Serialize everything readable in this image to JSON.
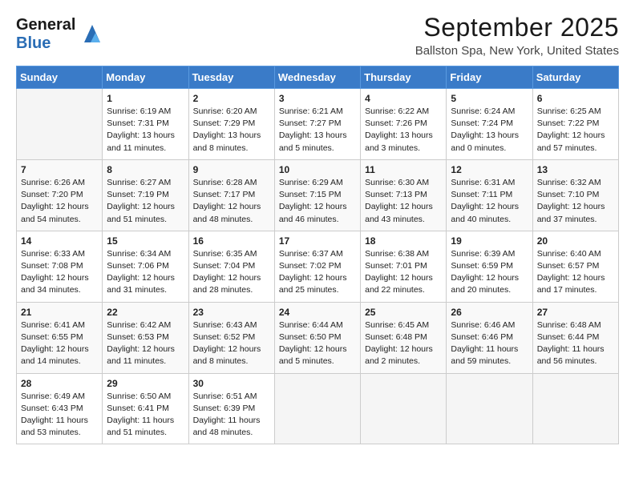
{
  "header": {
    "logo_general": "General",
    "logo_blue": "Blue",
    "month_title": "September 2025",
    "location": "Ballston Spa, New York, United States"
  },
  "columns": [
    "Sunday",
    "Monday",
    "Tuesday",
    "Wednesday",
    "Thursday",
    "Friday",
    "Saturday"
  ],
  "weeks": [
    [
      {
        "day": "",
        "info": ""
      },
      {
        "day": "1",
        "info": "Sunrise: 6:19 AM\nSunset: 7:31 PM\nDaylight: 13 hours\nand 11 minutes."
      },
      {
        "day": "2",
        "info": "Sunrise: 6:20 AM\nSunset: 7:29 PM\nDaylight: 13 hours\nand 8 minutes."
      },
      {
        "day": "3",
        "info": "Sunrise: 6:21 AM\nSunset: 7:27 PM\nDaylight: 13 hours\nand 5 minutes."
      },
      {
        "day": "4",
        "info": "Sunrise: 6:22 AM\nSunset: 7:26 PM\nDaylight: 13 hours\nand 3 minutes."
      },
      {
        "day": "5",
        "info": "Sunrise: 6:24 AM\nSunset: 7:24 PM\nDaylight: 13 hours\nand 0 minutes."
      },
      {
        "day": "6",
        "info": "Sunrise: 6:25 AM\nSunset: 7:22 PM\nDaylight: 12 hours\nand 57 minutes."
      }
    ],
    [
      {
        "day": "7",
        "info": "Sunrise: 6:26 AM\nSunset: 7:20 PM\nDaylight: 12 hours\nand 54 minutes."
      },
      {
        "day": "8",
        "info": "Sunrise: 6:27 AM\nSunset: 7:19 PM\nDaylight: 12 hours\nand 51 minutes."
      },
      {
        "day": "9",
        "info": "Sunrise: 6:28 AM\nSunset: 7:17 PM\nDaylight: 12 hours\nand 48 minutes."
      },
      {
        "day": "10",
        "info": "Sunrise: 6:29 AM\nSunset: 7:15 PM\nDaylight: 12 hours\nand 46 minutes."
      },
      {
        "day": "11",
        "info": "Sunrise: 6:30 AM\nSunset: 7:13 PM\nDaylight: 12 hours\nand 43 minutes."
      },
      {
        "day": "12",
        "info": "Sunrise: 6:31 AM\nSunset: 7:11 PM\nDaylight: 12 hours\nand 40 minutes."
      },
      {
        "day": "13",
        "info": "Sunrise: 6:32 AM\nSunset: 7:10 PM\nDaylight: 12 hours\nand 37 minutes."
      }
    ],
    [
      {
        "day": "14",
        "info": "Sunrise: 6:33 AM\nSunset: 7:08 PM\nDaylight: 12 hours\nand 34 minutes."
      },
      {
        "day": "15",
        "info": "Sunrise: 6:34 AM\nSunset: 7:06 PM\nDaylight: 12 hours\nand 31 minutes."
      },
      {
        "day": "16",
        "info": "Sunrise: 6:35 AM\nSunset: 7:04 PM\nDaylight: 12 hours\nand 28 minutes."
      },
      {
        "day": "17",
        "info": "Sunrise: 6:37 AM\nSunset: 7:02 PM\nDaylight: 12 hours\nand 25 minutes."
      },
      {
        "day": "18",
        "info": "Sunrise: 6:38 AM\nSunset: 7:01 PM\nDaylight: 12 hours\nand 22 minutes."
      },
      {
        "day": "19",
        "info": "Sunrise: 6:39 AM\nSunset: 6:59 PM\nDaylight: 12 hours\nand 20 minutes."
      },
      {
        "day": "20",
        "info": "Sunrise: 6:40 AM\nSunset: 6:57 PM\nDaylight: 12 hours\nand 17 minutes."
      }
    ],
    [
      {
        "day": "21",
        "info": "Sunrise: 6:41 AM\nSunset: 6:55 PM\nDaylight: 12 hours\nand 14 minutes."
      },
      {
        "day": "22",
        "info": "Sunrise: 6:42 AM\nSunset: 6:53 PM\nDaylight: 12 hours\nand 11 minutes."
      },
      {
        "day": "23",
        "info": "Sunrise: 6:43 AM\nSunset: 6:52 PM\nDaylight: 12 hours\nand 8 minutes."
      },
      {
        "day": "24",
        "info": "Sunrise: 6:44 AM\nSunset: 6:50 PM\nDaylight: 12 hours\nand 5 minutes."
      },
      {
        "day": "25",
        "info": "Sunrise: 6:45 AM\nSunset: 6:48 PM\nDaylight: 12 hours\nand 2 minutes."
      },
      {
        "day": "26",
        "info": "Sunrise: 6:46 AM\nSunset: 6:46 PM\nDaylight: 11 hours\nand 59 minutes."
      },
      {
        "day": "27",
        "info": "Sunrise: 6:48 AM\nSunset: 6:44 PM\nDaylight: 11 hours\nand 56 minutes."
      }
    ],
    [
      {
        "day": "28",
        "info": "Sunrise: 6:49 AM\nSunset: 6:43 PM\nDaylight: 11 hours\nand 53 minutes."
      },
      {
        "day": "29",
        "info": "Sunrise: 6:50 AM\nSunset: 6:41 PM\nDaylight: 11 hours\nand 51 minutes."
      },
      {
        "day": "30",
        "info": "Sunrise: 6:51 AM\nSunset: 6:39 PM\nDaylight: 11 hours\nand 48 minutes."
      },
      {
        "day": "",
        "info": ""
      },
      {
        "day": "",
        "info": ""
      },
      {
        "day": "",
        "info": ""
      },
      {
        "day": "",
        "info": ""
      }
    ]
  ]
}
